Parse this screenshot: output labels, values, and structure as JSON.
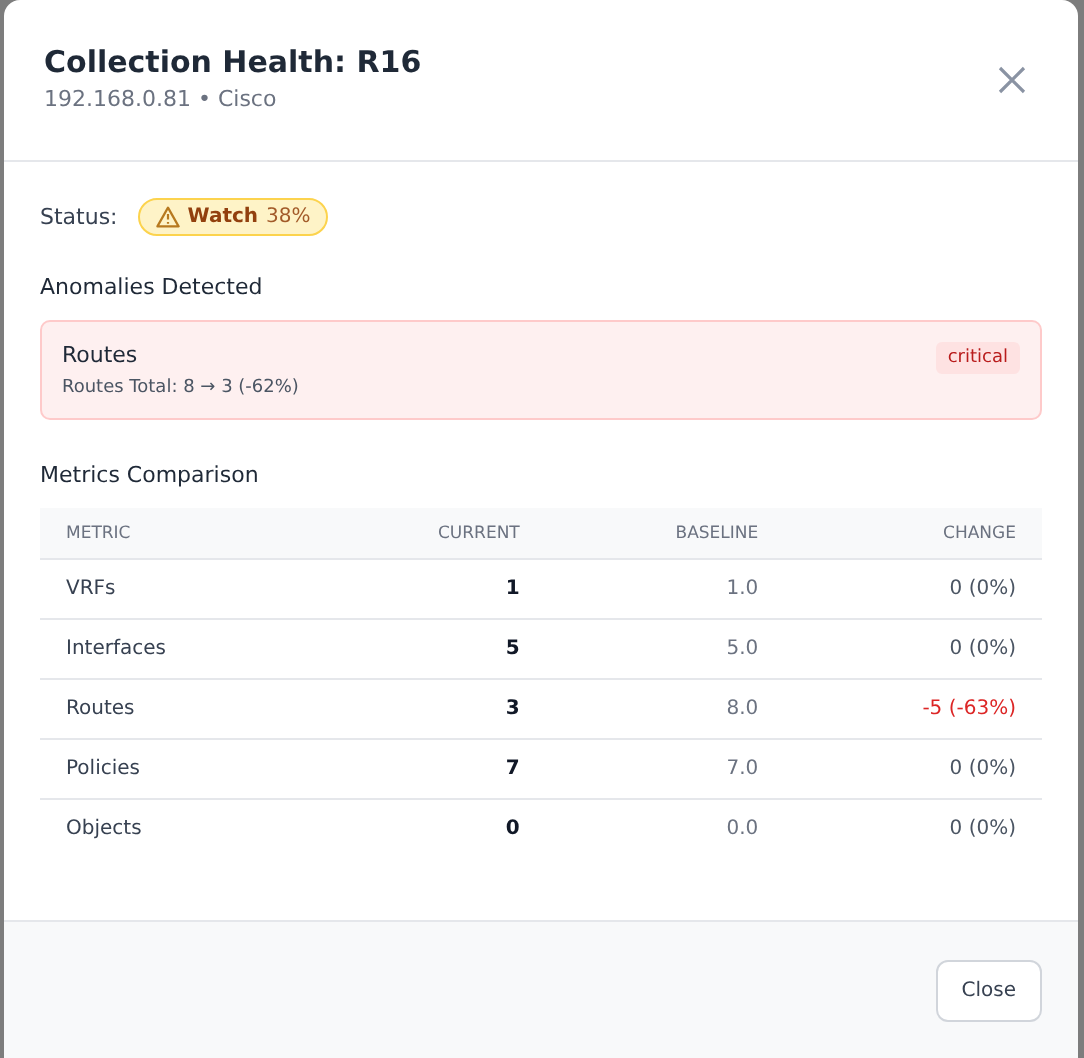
{
  "dialog": {
    "title": "Collection Health: R16",
    "subtitle": "192.168.0.81 • Cisco"
  },
  "status": {
    "label": "Status:",
    "badge": {
      "kind": "watch",
      "text": "Watch",
      "percent": "38%"
    }
  },
  "anomalies": {
    "heading": "Anomalies Detected",
    "items": [
      {
        "title": "Routes",
        "detail": "Routes Total: 8 → 3 (-62%)",
        "severity": "critical"
      }
    ]
  },
  "metrics": {
    "heading": "Metrics Comparison",
    "columns": [
      "METRIC",
      "CURRENT",
      "BASELINE",
      "CHANGE"
    ],
    "rows": [
      {
        "metric": "VRFs",
        "current": "1",
        "baseline": "1.0",
        "change": "0 (0%)",
        "negative": false
      },
      {
        "metric": "Interfaces",
        "current": "5",
        "baseline": "5.0",
        "change": "0 (0%)",
        "negative": false
      },
      {
        "metric": "Routes",
        "current": "3",
        "baseline": "8.0",
        "change": "-5 (-63%)",
        "negative": true
      },
      {
        "metric": "Policies",
        "current": "7",
        "baseline": "7.0",
        "change": "0 (0%)",
        "negative": false
      },
      {
        "metric": "Objects",
        "current": "0",
        "baseline": "0.0",
        "change": "0 (0%)",
        "negative": false
      }
    ]
  },
  "buttons": [
    "Close"
  ]
}
